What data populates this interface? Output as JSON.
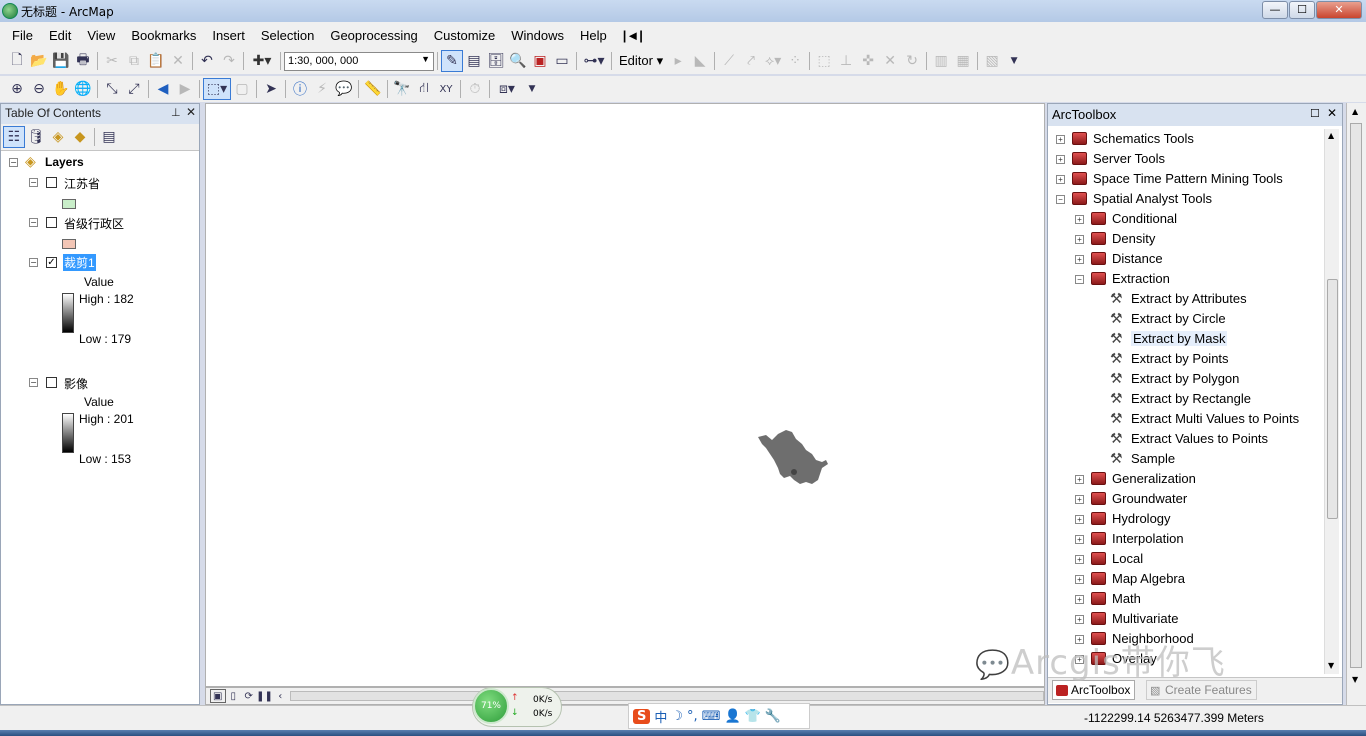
{
  "window": {
    "title": "无标题 - ArcMap",
    "min": "—",
    "max": "☐",
    "close": "✕"
  },
  "menu": [
    "File",
    "Edit",
    "View",
    "Bookmarks",
    "Insert",
    "Selection",
    "Geoprocessing",
    "Customize",
    "Windows",
    "Help"
  ],
  "toolbar": {
    "scale_value": "1:30, 000, 000",
    "editor_label": "Editor"
  },
  "toc": {
    "title": "Table Of Contents",
    "pin": "📌",
    "close": "✕",
    "root": "Layers",
    "layers": [
      {
        "name": "江苏省",
        "checked": false,
        "swatch": "#c9eec9"
      },
      {
        "name": "省级行政区",
        "checked": false,
        "swatch": "#f3c6b6"
      },
      {
        "name": "裁剪1",
        "checked": true,
        "value_label": "Value",
        "high": "High : 182",
        "low": "Low : 179"
      },
      {
        "name": "影像",
        "checked": false,
        "value_label": "Value",
        "high": "High : 201",
        "low": "Low : 153"
      }
    ]
  },
  "toolbox": {
    "title": "ArcToolbox",
    "rows": [
      {
        "label": "Schematics Tools",
        "kind": "toolbox",
        "expander": "+"
      },
      {
        "label": "Server Tools",
        "kind": "toolbox",
        "expander": "+"
      },
      {
        "label": "Space Time Pattern Mining Tools",
        "kind": "toolbox",
        "expander": "+"
      },
      {
        "label": "Spatial Analyst Tools",
        "kind": "toolbox",
        "expander": "−"
      },
      {
        "label": "Conditional",
        "kind": "toolset",
        "expander": "+"
      },
      {
        "label": "Density",
        "kind": "toolset",
        "expander": "+"
      },
      {
        "label": "Distance",
        "kind": "toolset",
        "expander": "+"
      },
      {
        "label": "Extraction",
        "kind": "toolset",
        "expander": "−"
      },
      {
        "label": "Extract by Attributes",
        "kind": "tool"
      },
      {
        "label": "Extract by Circle",
        "kind": "tool"
      },
      {
        "label": "Extract by Mask",
        "kind": "tool"
      },
      {
        "label": "Extract by Points",
        "kind": "tool"
      },
      {
        "label": "Extract by Polygon",
        "kind": "tool"
      },
      {
        "label": "Extract by Rectangle",
        "kind": "tool"
      },
      {
        "label": "Extract Multi Values to Points",
        "kind": "tool"
      },
      {
        "label": "Extract Values to Points",
        "kind": "tool"
      },
      {
        "label": "Sample",
        "kind": "tool"
      },
      {
        "label": "Generalization",
        "kind": "toolset",
        "expander": "+"
      },
      {
        "label": "Groundwater",
        "kind": "toolset",
        "expander": "+"
      },
      {
        "label": "Hydrology",
        "kind": "toolset",
        "expander": "+"
      },
      {
        "label": "Interpolation",
        "kind": "toolset",
        "expander": "+"
      },
      {
        "label": "Local",
        "kind": "toolset",
        "expander": "+"
      },
      {
        "label": "Map Algebra",
        "kind": "toolset",
        "expander": "+"
      },
      {
        "label": "Math",
        "kind": "toolset",
        "expander": "+"
      },
      {
        "label": "Multivariate",
        "kind": "toolset",
        "expander": "+"
      },
      {
        "label": "Neighborhood",
        "kind": "toolset",
        "expander": "+"
      },
      {
        "label": "Overlay",
        "kind": "toolset",
        "expander": "+"
      }
    ],
    "tabs": [
      "ArcToolbox",
      "Create Features"
    ]
  },
  "status": {
    "coordinates": "-1122299.14  5263477.399 Meters"
  },
  "net": {
    "percent": "71%",
    "up": "0K/s",
    "down": "0K/s"
  },
  "ime": {
    "mode": "中"
  },
  "watermark": "Arcgis带你飞"
}
